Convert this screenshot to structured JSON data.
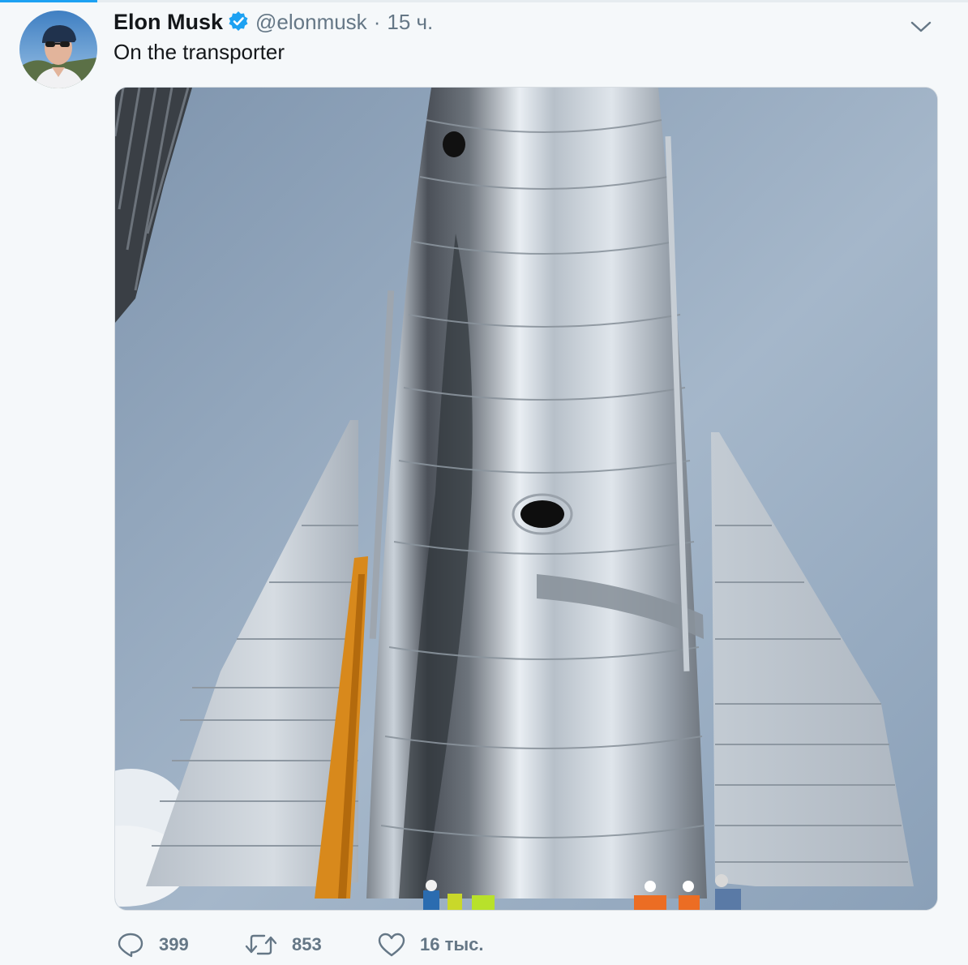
{
  "tweet": {
    "author_name": "Elon Musk",
    "handle": "@elonmusk",
    "separator": "·",
    "time": "15 ч.",
    "text": "On the transporter"
  },
  "actions": {
    "replies": "399",
    "retweets": "853",
    "likes": "16 тыс."
  },
  "icons": {
    "verified": "verified-badge-icon",
    "caret": "chevron-down-icon",
    "reply": "speech-bubble-icon",
    "retweet": "retweet-arrows-icon",
    "like": "heart-icon"
  },
  "colors": {
    "accent": "#1da1f2",
    "text_primary": "#14171a",
    "text_secondary": "#657786",
    "background": "#f5f8fa"
  }
}
